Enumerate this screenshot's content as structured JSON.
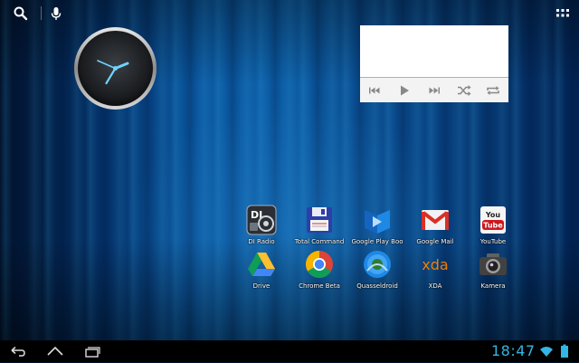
{
  "top_bar": {
    "search_icon": "search-icon",
    "voice_icon": "microphone-icon",
    "apps_icon": "all-apps-grid-icon"
  },
  "widgets": {
    "clock": {
      "type": "analog-clock",
      "time_shown": "1:51"
    },
    "music": {
      "controls": [
        "previous-icon",
        "play-icon",
        "next-icon",
        "shuffle-icon",
        "repeat-icon"
      ]
    }
  },
  "apps": [
    {
      "label": "DI Radio",
      "icon": "di-radio-icon"
    },
    {
      "label": "Total Command",
      "icon": "floppy-disk-icon"
    },
    {
      "label": "Google Play Boo",
      "icon": "play-books-icon"
    },
    {
      "label": "Google Mail",
      "icon": "gmail-icon"
    },
    {
      "label": "YouTube",
      "icon": "youtube-icon"
    },
    {
      "label": "Drive",
      "icon": "drive-icon"
    },
    {
      "label": "Chrome Beta",
      "icon": "chrome-icon"
    },
    {
      "label": "Quasseldroid",
      "icon": "quasseldroid-icon"
    },
    {
      "label": "XDA",
      "icon": "xda-icon"
    },
    {
      "label": "Kamera",
      "icon": "camera-icon"
    }
  ],
  "nav_bar": {
    "back_icon": "back-icon",
    "home_icon": "home-icon",
    "recents_icon": "recent-apps-icon"
  },
  "status": {
    "time": "18:47",
    "wifi_icon": "wifi-icon",
    "battery_icon": "battery-icon"
  },
  "colors": {
    "accent": "#33b5e5",
    "wallpaper": "#0a58a0"
  }
}
